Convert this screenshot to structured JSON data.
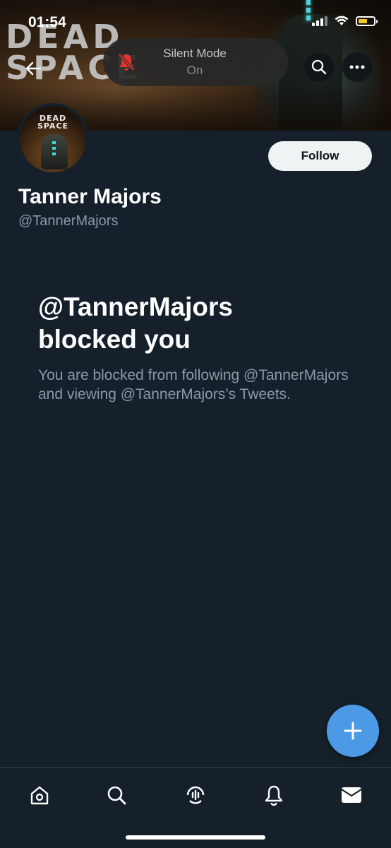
{
  "status_bar": {
    "time": "01:54"
  },
  "banner": {
    "logo_line1": "DEAD",
    "logo_line2": "SPACE"
  },
  "toast": {
    "title": "Silent Mode",
    "subtitle": "On"
  },
  "header": {
    "back_icon": "arrow-left-icon",
    "search_icon": "search-icon",
    "more_icon": "more-icon"
  },
  "avatar": {
    "text_line1": "DEAD",
    "text_line2": "SPACE"
  },
  "profile": {
    "display_name": "Tanner Majors",
    "handle": "@TannerMajors",
    "follow_label": "Follow"
  },
  "blocked": {
    "title_line1": "@TannerMajors",
    "title_line2": "blocked you",
    "description": "You are blocked from following @TannerMajors and viewing @TannerMajors’s Tweets."
  },
  "tabbar": {
    "items": [
      "home-icon",
      "search-icon",
      "spaces-icon",
      "notifications-icon",
      "messages-icon"
    ]
  },
  "colors": {
    "background": "#15202b",
    "accent": "#4c9ae6",
    "secondary_text": "#8b98a5",
    "alert_red": "#e0362c"
  }
}
